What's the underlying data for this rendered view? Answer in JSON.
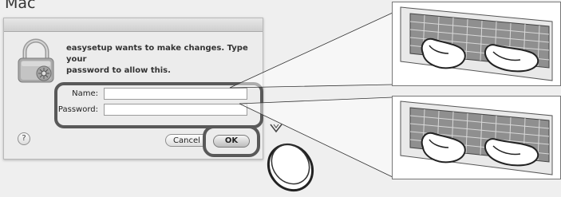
{
  "platform_label": "Mac",
  "dialog": {
    "message_line1": "easysetup wants to make changes. Type your",
    "message_line2": "password to allow this.",
    "name_label": "Name:",
    "name_value": "",
    "password_label": "Password:",
    "password_value": "",
    "help_label": "?",
    "cancel_label": "Cancel",
    "ok_label": "OK"
  },
  "colors": {
    "highlight_frame": "#595959",
    "dialog_bg": "#ececec",
    "page_bg": "#efefef"
  },
  "icons": {
    "lock": "lock-icon",
    "scroll_down": "chevron-down-icon",
    "keyboard_hands": "keyboard-typing-illustration",
    "press_button": "button-press-illustration"
  }
}
